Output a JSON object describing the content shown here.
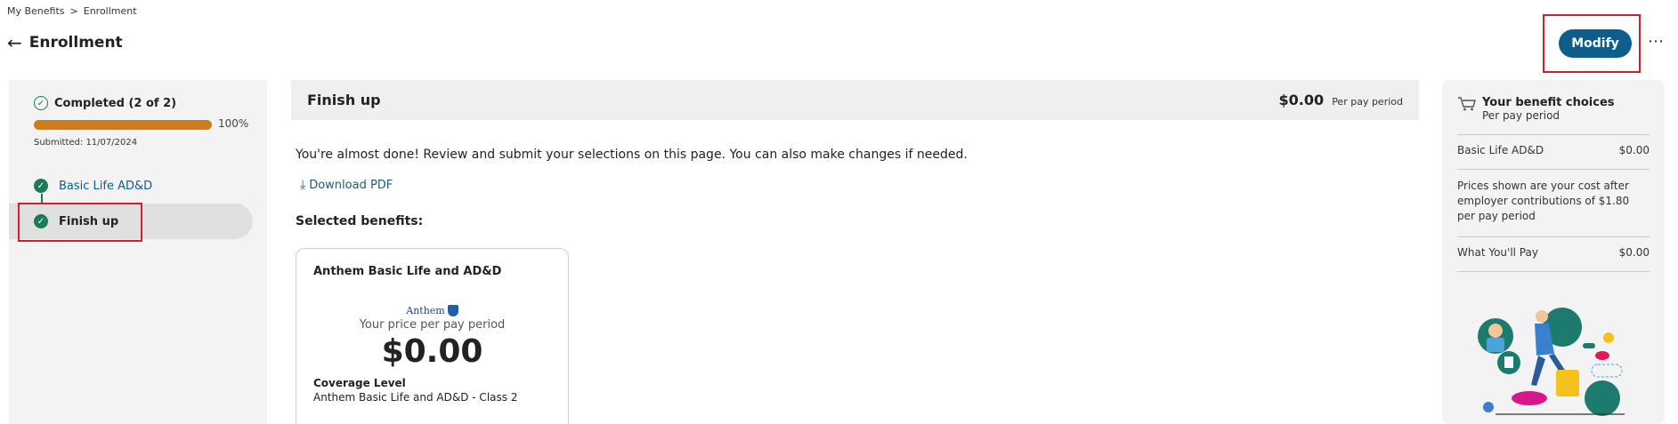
{
  "breadcrumb": {
    "parent": "My Benefits",
    "separator": ">",
    "current": "Enrollment"
  },
  "header": {
    "title": "Enrollment",
    "modify_label": "Modify"
  },
  "progress": {
    "label": "Completed (2 of 2)",
    "percent_text": "100%",
    "percent": 1.0,
    "submitted": "Submitted: 11/07/2024"
  },
  "steps": [
    {
      "label": "Basic Life AD&D"
    },
    {
      "label": "Finish up"
    }
  ],
  "main": {
    "title": "Finish up",
    "total_price": "$0.00",
    "price_period": "Per pay period",
    "intro": "You're almost done! Review and submit your selections on this page. You can also make changes if needed.",
    "download_label": "Download PDF",
    "selected_title": "Selected benefits:"
  },
  "card": {
    "title": "Anthem Basic Life and AD&D",
    "logo_text": "Anthem",
    "price_label": "Your price per pay period",
    "price": "$0.00",
    "coverage_label": "Coverage Level",
    "coverage_value": "Anthem Basic Life and AD&D - Class 2"
  },
  "summary": {
    "title": "Your benefit choices",
    "subtitle": "Per pay period",
    "item_label": "Basic Life AD&D",
    "item_price": "$0.00",
    "note": "Prices shown are your cost after employer contributions of $1.80 per pay period",
    "total_label": "What You'll Pay",
    "total_price": "$0.00"
  },
  "colors": {
    "primary": "#0f5d8c",
    "success": "#1d7a57",
    "progress": "#d27b1c",
    "highlight": "#d0202e"
  }
}
